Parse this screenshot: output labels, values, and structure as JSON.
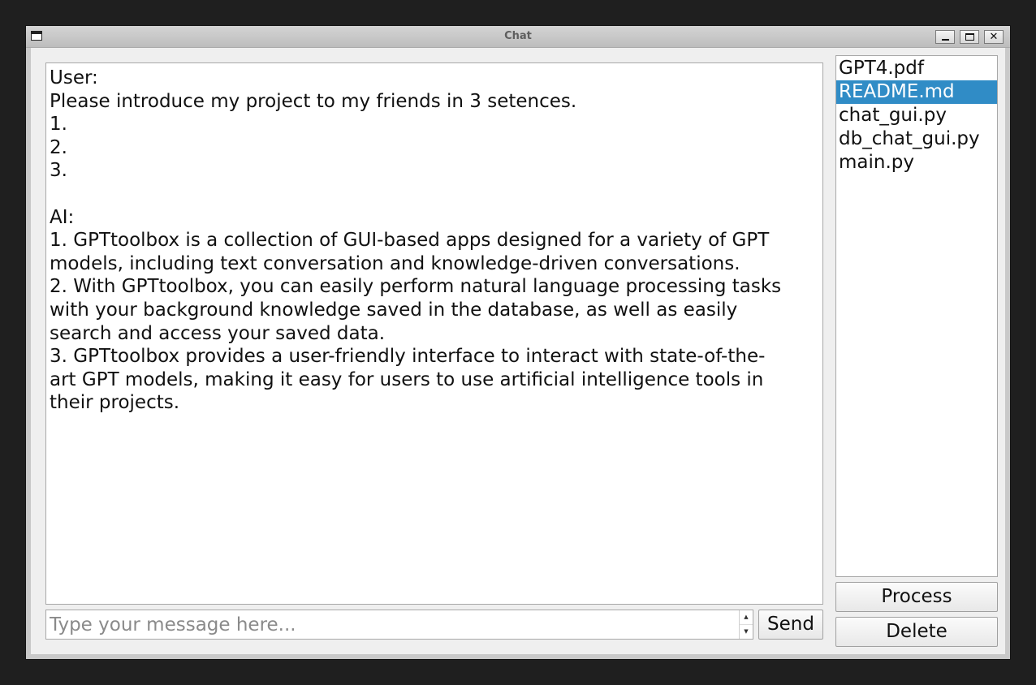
{
  "window": {
    "title": "Chat"
  },
  "chat": {
    "lines": [
      "User:",
      "Please introduce my project to my friends in 3 setences.",
      "1.",
      "2.",
      "3.",
      "",
      "AI:",
      "1. GPTtoolbox is a collection of GUI-based apps designed for a variety of GPT",
      "models, including text conversation and knowledge-driven conversations.",
      "2. With GPTtoolbox, you can easily perform natural language processing tasks",
      "with your background knowledge saved in the database, as well as easily",
      "search and access your saved data.",
      "3. GPTtoolbox provides a user-friendly interface to interact with state-of-the-",
      "art GPT models, making it easy for users to use artificial intelligence tools in",
      "their projects."
    ]
  },
  "input": {
    "placeholder": "Type your message here...",
    "value": ""
  },
  "buttons": {
    "send": "Send",
    "process": "Process",
    "delete": "Delete"
  },
  "files": {
    "items": [
      "GPT4.pdf",
      "README.md",
      "chat_gui.py",
      "db_chat_gui.py",
      "main.py"
    ],
    "selected": "README.md"
  },
  "colors": {
    "selection": "#308cc6",
    "background": "#efefef"
  },
  "icons": {
    "window": "app-window-icon",
    "minimize": "minimize-icon",
    "maximize": "maximize-icon",
    "close": "close-icon",
    "spin_up": "arrow-up-icon",
    "spin_down": "arrow-down-icon"
  }
}
